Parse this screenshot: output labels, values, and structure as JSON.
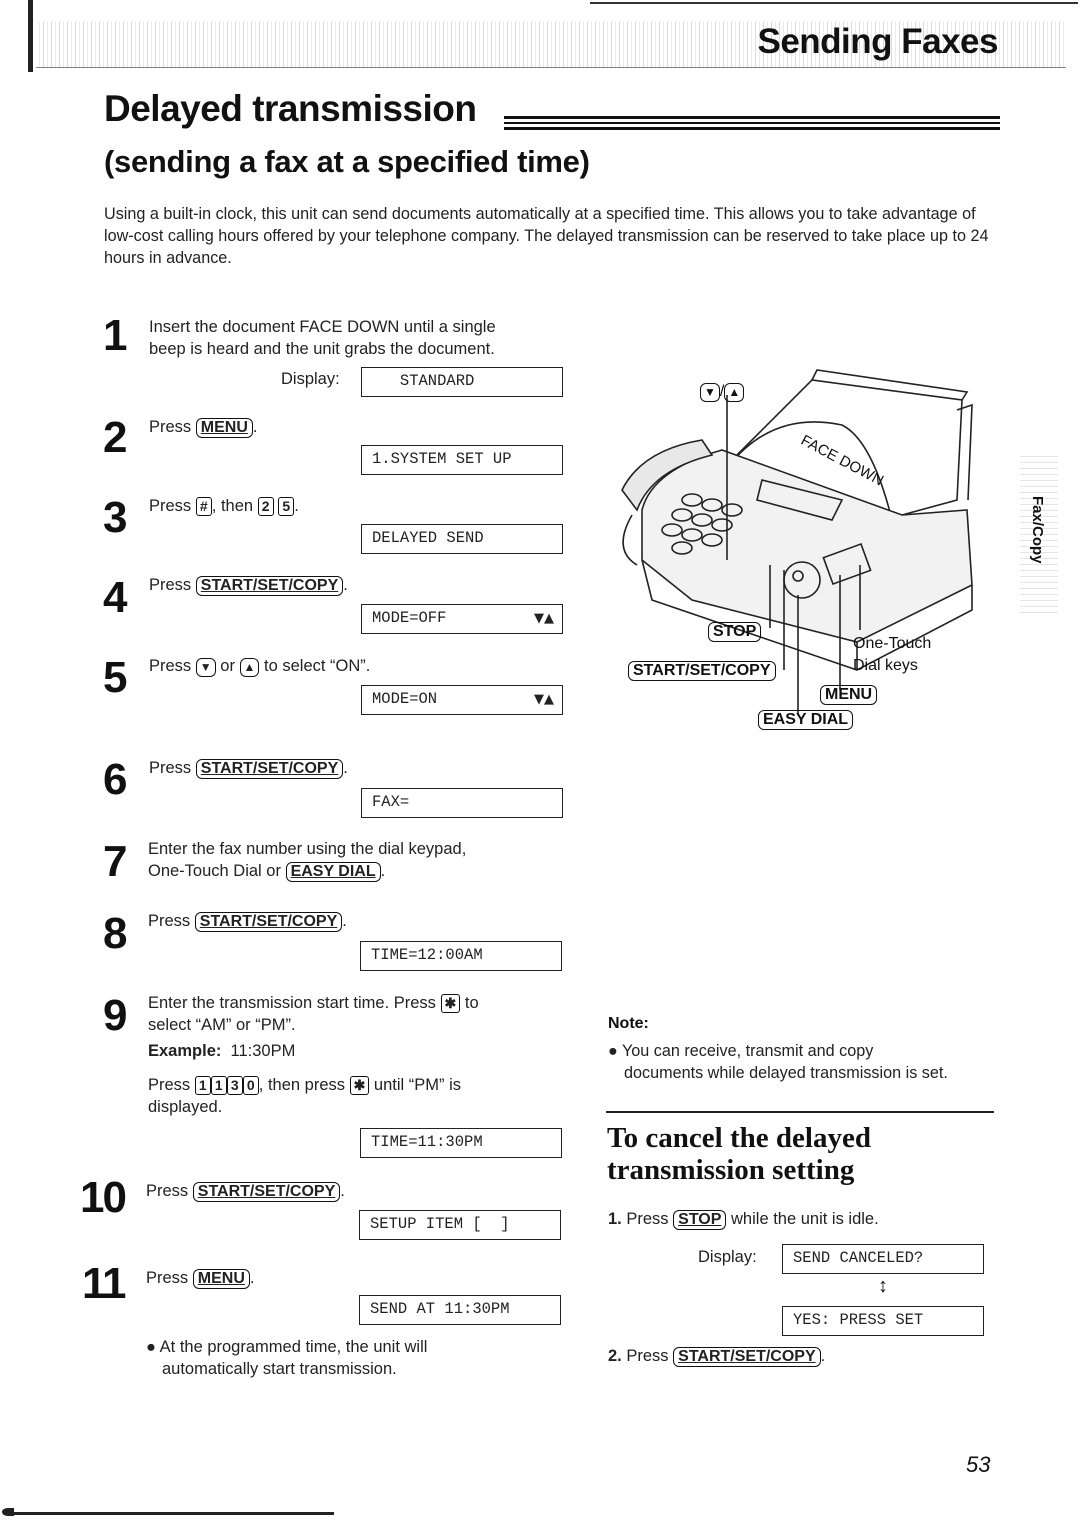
{
  "header": {
    "section_title": "Sending Faxes",
    "side_tab": "Fax/Copy"
  },
  "title": "Delayed transmission",
  "subtitle": "(sending a fax at a specified time)",
  "intro": "Using a built-in clock, this unit can send documents automatically at a specified time. This allows you to take advantage of low-cost calling hours offered by your telephone company. The delayed transmission can be reserved to take place up to 24 hours in advance.",
  "display_label": "Display:",
  "keys": {
    "menu": "MENU",
    "start_set_copy": "START/SET/COPY",
    "easy_dial": "EASY DIAL",
    "stop": "STOP",
    "hash": "#",
    "star": "✱",
    "down": "▼",
    "up": "▲",
    "two": "2",
    "five": "5",
    "one": "1",
    "three": "3",
    "zero": "0"
  },
  "steps": [
    {
      "num": "1",
      "text_a": "Insert the document FACE DOWN until a single",
      "text_b": "beep is heard and the unit grabs the document.",
      "display": "   STANDARD"
    },
    {
      "num": "2",
      "text_a": "Press",
      "text_b": ".",
      "display": "1.SYSTEM SET UP"
    },
    {
      "num": "3",
      "text_a": "Press",
      "text_b": ", then",
      "text_c": ".",
      "display": "DELAYED SEND"
    },
    {
      "num": "4",
      "text_a": "Press",
      "text_b": ".",
      "display": "MODE=OFF",
      "arrows": "▼▲"
    },
    {
      "num": "5",
      "text_a": "Press",
      "text_b": "or",
      "text_c": "to select “ON”.",
      "display": "MODE=ON",
      "arrows": "▼▲"
    },
    {
      "num": "6",
      "text_a": "Press",
      "text_b": ".",
      "display": "FAX="
    },
    {
      "num": "7",
      "text_a": "Enter the fax number using the dial keypad,",
      "text_b": "One-Touch Dial or",
      "text_c": "."
    },
    {
      "num": "8",
      "text_a": "Press",
      "text_b": ".",
      "display": "TIME=12:00AM"
    },
    {
      "num": "9",
      "text_a": "Enter the transmission start time. Press",
      "text_b": "to",
      "text_c": "select “AM” or “PM”.",
      "example_label": "Example:",
      "example_value": "11:30PM",
      "press": "Press",
      "then_press": ", then press",
      "until": "until “PM” is",
      "displayed": "displayed.",
      "display": "TIME=11:30PM"
    },
    {
      "num": "10",
      "text_a": "Press",
      "text_b": ".",
      "display": "SETUP ITEM [  ]"
    },
    {
      "num": "11",
      "text_a": "Press",
      "text_b": ".",
      "display": "SEND AT 11:30PM",
      "bullet_a": "At the programmed time, the unit will",
      "bullet_b": "automatically start transmission."
    }
  ],
  "illustration": {
    "paper_label": "FACE DOWN",
    "callouts": {
      "updown": "▼/▲",
      "stop": "STOP",
      "start": "START/SET/COPY",
      "menu": "MENU",
      "easy_dial": "EASY DIAL",
      "one_touch_a": "One-Touch",
      "one_touch_b": "Dial keys"
    }
  },
  "note": {
    "title": "Note:",
    "text_a": "You can receive, transmit and copy",
    "text_b": "documents while delayed transmission is set."
  },
  "cancel": {
    "title_a": "To cancel the delayed",
    "title_b": "transmission setting",
    "step1_num": "1.",
    "step1_a": "Press",
    "step1_b": "while the unit is idle.",
    "display_1": "SEND CANCELED?",
    "toggle_arrow": "↕",
    "display_2": "YES: PRESS SET",
    "step2_num": "2.",
    "step2_a": "Press",
    "step2_b": "."
  },
  "page_number": "53"
}
